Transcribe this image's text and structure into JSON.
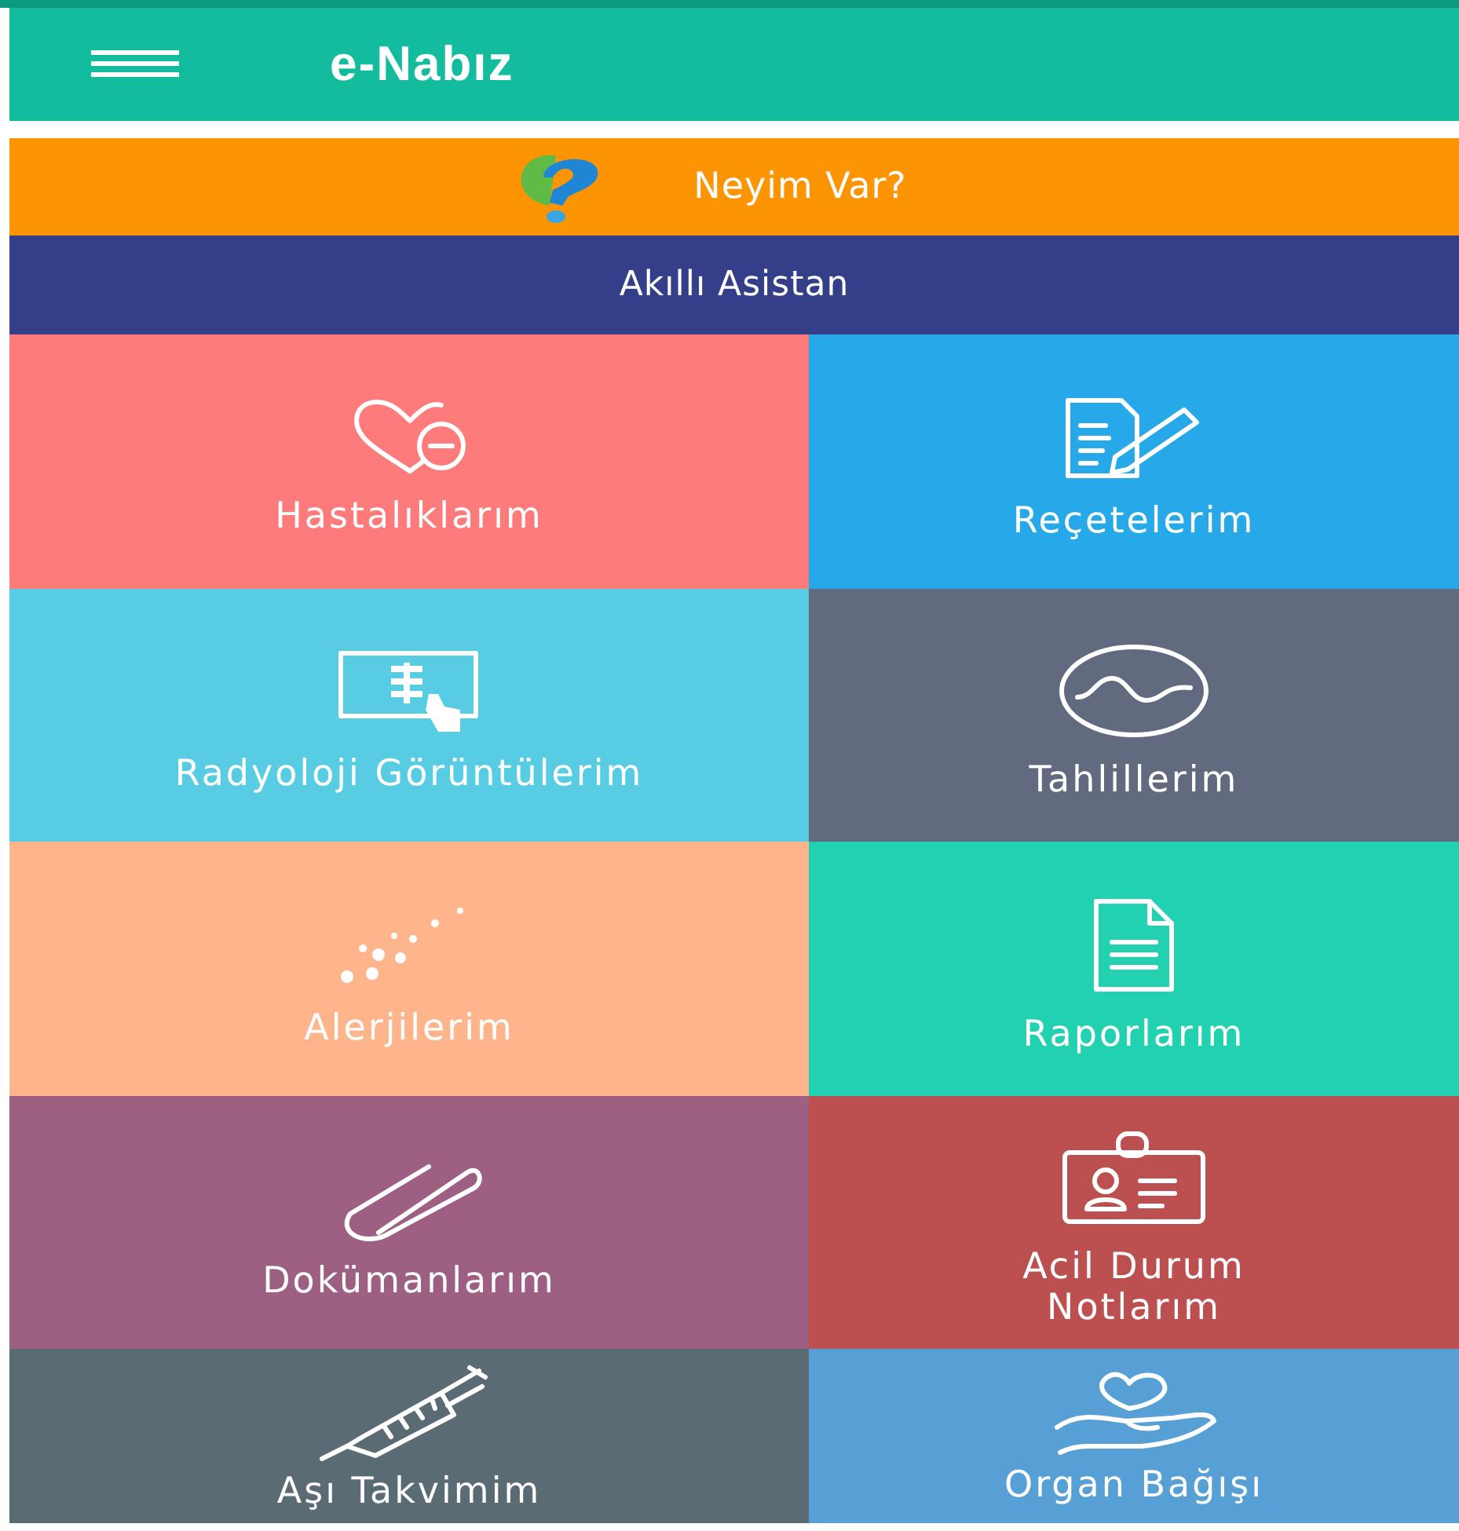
{
  "app_bar": {
    "title": "e-Nabız"
  },
  "banners": [
    {
      "kind": "symptom",
      "label": "Neyim Var?",
      "color": "#fc9404"
    },
    {
      "kind": "assistant",
      "label": "Akıllı Asistan",
      "color": "#353e88"
    }
  ],
  "tiles": [
    {
      "kind": "heart",
      "label": "Hastalıklarım",
      "color": "#fe7b7b"
    },
    {
      "kind": "prescription",
      "label": "Reçetelerim",
      "color": "#27a9e9"
    },
    {
      "kind": "xray",
      "label": "Radyoloji Görüntülerim",
      "color": "#57cce3"
    },
    {
      "kind": "wave",
      "label": "Tahlillerim",
      "color": "#616a7e"
    },
    {
      "kind": "dots",
      "label": "Alerjilerim",
      "color": "#feb58c"
    },
    {
      "kind": "report",
      "label": "Raporlarım",
      "color": "#22d1b0"
    },
    {
      "kind": "clip",
      "label": "Dokümanlarım",
      "color": "#9d6083"
    },
    {
      "kind": "badge",
      "label": "Acil Durum Notlarım",
      "color": "#bc5050"
    },
    {
      "kind": "syringe",
      "label": "Aşı Takvimim",
      "color": "#5b6b74"
    },
    {
      "kind": "hand",
      "label": "Organ Bağışı",
      "color": "#57a0d6"
    }
  ]
}
